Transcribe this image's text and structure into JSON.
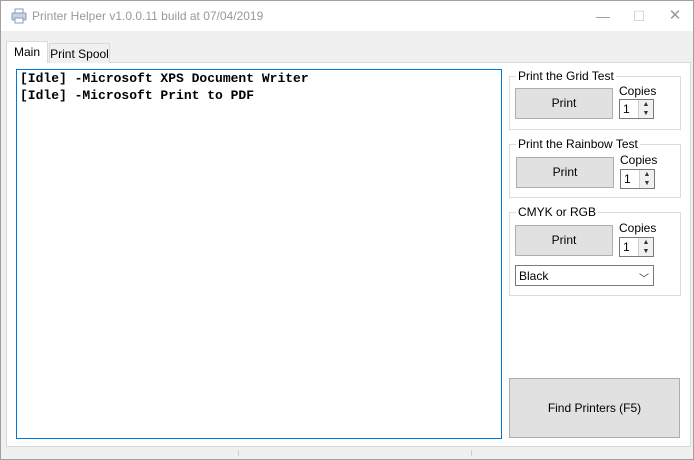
{
  "window": {
    "title": "Printer Helper v1.0.0.11 build at 07/04/2019",
    "icon": "printer-icon",
    "min_glyph": "—",
    "max_glyph": "☐",
    "close_glyph": "✕"
  },
  "tabs": [
    {
      "label": "Main",
      "active": true
    },
    {
      "label": "Print Spool",
      "active": false
    }
  ],
  "printers": [
    "[Idle] -Microsoft XPS Document Writer",
    "[Idle] -Microsoft Print to PDF"
  ],
  "grid_test": {
    "title": "Print the Grid Test",
    "print_label": "Print",
    "copies_label": "Copies",
    "copies_value": "1"
  },
  "rainbow_test": {
    "title": "Print the Rainbow Test",
    "print_label": "Print",
    "copies_label": "Copies",
    "copies_value": "1"
  },
  "cmyk_rgb": {
    "title": "CMYK or RGB",
    "print_label": "Print",
    "copies_label": "Copies",
    "copies_value": "1",
    "color_selected": "Black"
  },
  "find_printers": {
    "label": "Find Printers (F5)"
  },
  "colors": {
    "accent": "#0078d7",
    "button_bg": "#e1e1e1"
  }
}
